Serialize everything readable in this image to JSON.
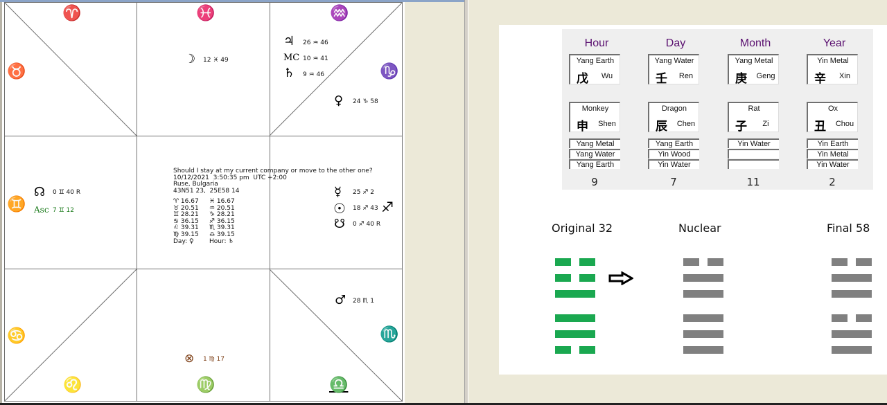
{
  "chart": {
    "signs": {
      "aries": "♈",
      "pisces": "♓",
      "aquarius": "♒",
      "taurus": "♉",
      "capricorn": "♑",
      "gemini": "♊",
      "cancer": "♋",
      "leo": "♌",
      "virgo": "♍",
      "libra": "♎",
      "scorpio": "♏"
    },
    "planets": [
      {
        "name": "moon",
        "glyph": "☽",
        "pos": "12 ♓ 49",
        "color": "#111111"
      },
      {
        "name": "jupiter",
        "glyph": "♃",
        "pos": "26 ♒ 46",
        "color": "#111111"
      },
      {
        "name": "mc",
        "glyph": "MC",
        "pos": "10 ♒ 41",
        "color": "#111111"
      },
      {
        "name": "saturn",
        "glyph": "♄",
        "pos": "9 ♒ 46",
        "color": "#111111"
      },
      {
        "name": "venus",
        "glyph": "♀",
        "pos": "24 ♑ 58",
        "color": "#111111"
      },
      {
        "name": "north-node",
        "glyph": "☊",
        "pos": "0 ♊ 40 R",
        "color": "#111111"
      },
      {
        "name": "ascendant",
        "glyph": "Asc",
        "pos": "7 ♊ 12",
        "color": "#1a7a1a"
      },
      {
        "name": "mercury",
        "glyph": "☿",
        "pos": "25 ♐ 2",
        "color": "#111111"
      },
      {
        "name": "sun",
        "glyph": "☉",
        "pos": "18 ♐ 43",
        "color": "#111111"
      },
      {
        "name": "south-node",
        "glyph": "☋",
        "pos": "0 ♐ 40 R",
        "color": "#111111"
      },
      {
        "name": "mars",
        "glyph": "♂",
        "pos": "28 ♏ 1",
        "color": "#111111"
      },
      {
        "name": "part-of-fortune",
        "glyph": "⊗",
        "pos": "1 ♍ 17",
        "color": "#7a3a10"
      }
    ],
    "sagittarius_glyph": "♐",
    "info": {
      "question": "Should I stay at my current company or move to the other one?",
      "datetime": "10/12/2021  3:50:35 pm  UTC +2:00",
      "location": "Ruse, Bulgaria",
      "coords": "43N51 23,  25E58 14",
      "table": [
        [
          "♈ 16.67",
          "♓ 16.67"
        ],
        [
          "♉ 20.51",
          "♒ 20.51"
        ],
        [
          "♊ 28.21",
          "♑ 28.21"
        ],
        [
          "♋ 36.15",
          "♐ 36.15"
        ],
        [
          "♌ 39.31",
          "♏ 39.31"
        ],
        [
          "♍ 39.15",
          "♎ 39.15"
        ],
        [
          "Day:  ♀",
          "Hour:  ♄"
        ]
      ]
    }
  },
  "bazi": {
    "pillars": [
      {
        "title": "Hour",
        "stem_element": "Yang Earth",
        "stem_char": "戊",
        "stem_pinyin": "Wu",
        "branch_animal": "Monkey",
        "branch_char": "申",
        "branch_pinyin": "Shen",
        "hidden": [
          "Yang Metal",
          "Yang Water",
          "Yang Earth"
        ],
        "number": "9"
      },
      {
        "title": "Day",
        "stem_element": "Yang Water",
        "stem_char": "壬",
        "stem_pinyin": "Ren",
        "branch_animal": "Dragon",
        "branch_char": "辰",
        "branch_pinyin": "Chen",
        "hidden": [
          "Yang Earth",
          "Yin Wood",
          "Yin Water"
        ],
        "number": "7"
      },
      {
        "title": "Month",
        "stem_element": "Yang Metal",
        "stem_char": "庚",
        "stem_pinyin": "Geng",
        "branch_animal": "Rat",
        "branch_char": "子",
        "branch_pinyin": "Zi",
        "hidden": [
          "Yin Water",
          "",
          ""
        ],
        "number": "11"
      },
      {
        "title": "Year",
        "stem_element": "Yin Metal",
        "stem_char": "辛",
        "stem_pinyin": "Xin",
        "branch_animal": "Ox",
        "branch_char": "丑",
        "branch_pinyin": "Chou",
        "hidden": [
          "Yin Earth",
          "Yin Metal",
          "Yin Water"
        ],
        "number": "2"
      }
    ]
  },
  "hexagrams": {
    "original": {
      "label": "Original 32",
      "lines_top_to_bottom": [
        "broken",
        "broken",
        "solid",
        "solid",
        "solid",
        "broken"
      ],
      "color": "#1aa850"
    },
    "nuclear": {
      "label": "Nuclear",
      "lines_top_to_bottom": [
        "broken",
        "solid",
        "solid",
        "solid",
        "solid",
        "solid"
      ],
      "color": "#808080"
    },
    "final": {
      "label": "Final 58",
      "lines_top_to_bottom": [
        "broken",
        "solid",
        "solid",
        "broken",
        "solid",
        "solid"
      ],
      "color": "#808080"
    }
  }
}
